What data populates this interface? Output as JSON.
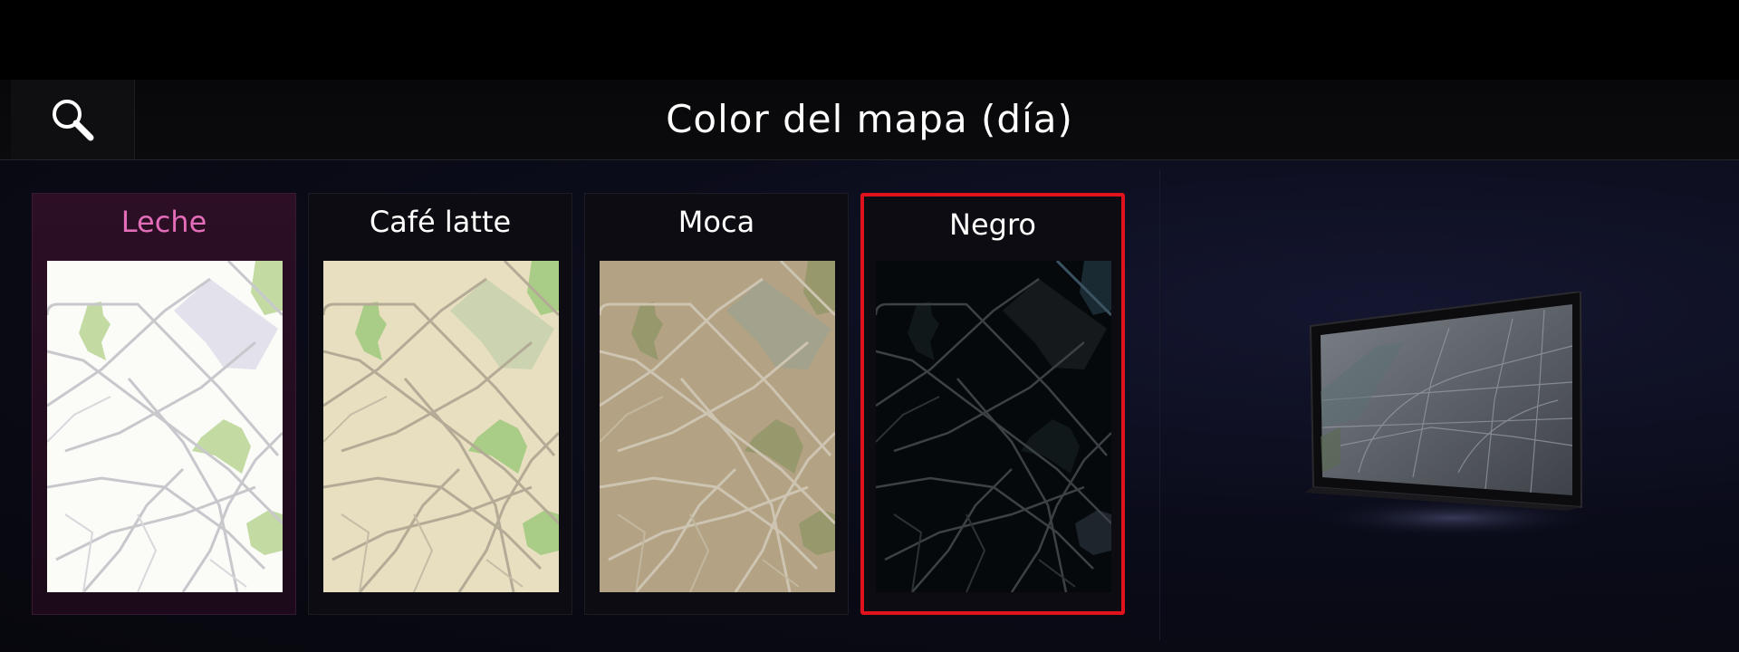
{
  "header": {
    "title": "Color del mapa (día)",
    "search_icon": "search-icon"
  },
  "theme_options": [
    {
      "label": "Leche",
      "state": "selected",
      "accent": "#e46db9"
    },
    {
      "label": "Café latte",
      "state": "normal"
    },
    {
      "label": "Moca",
      "state": "normal"
    },
    {
      "label": "Negro",
      "state": "focused",
      "focus_color": "#e0121b"
    }
  ],
  "preview": {
    "icon": "display-screen-preview"
  }
}
